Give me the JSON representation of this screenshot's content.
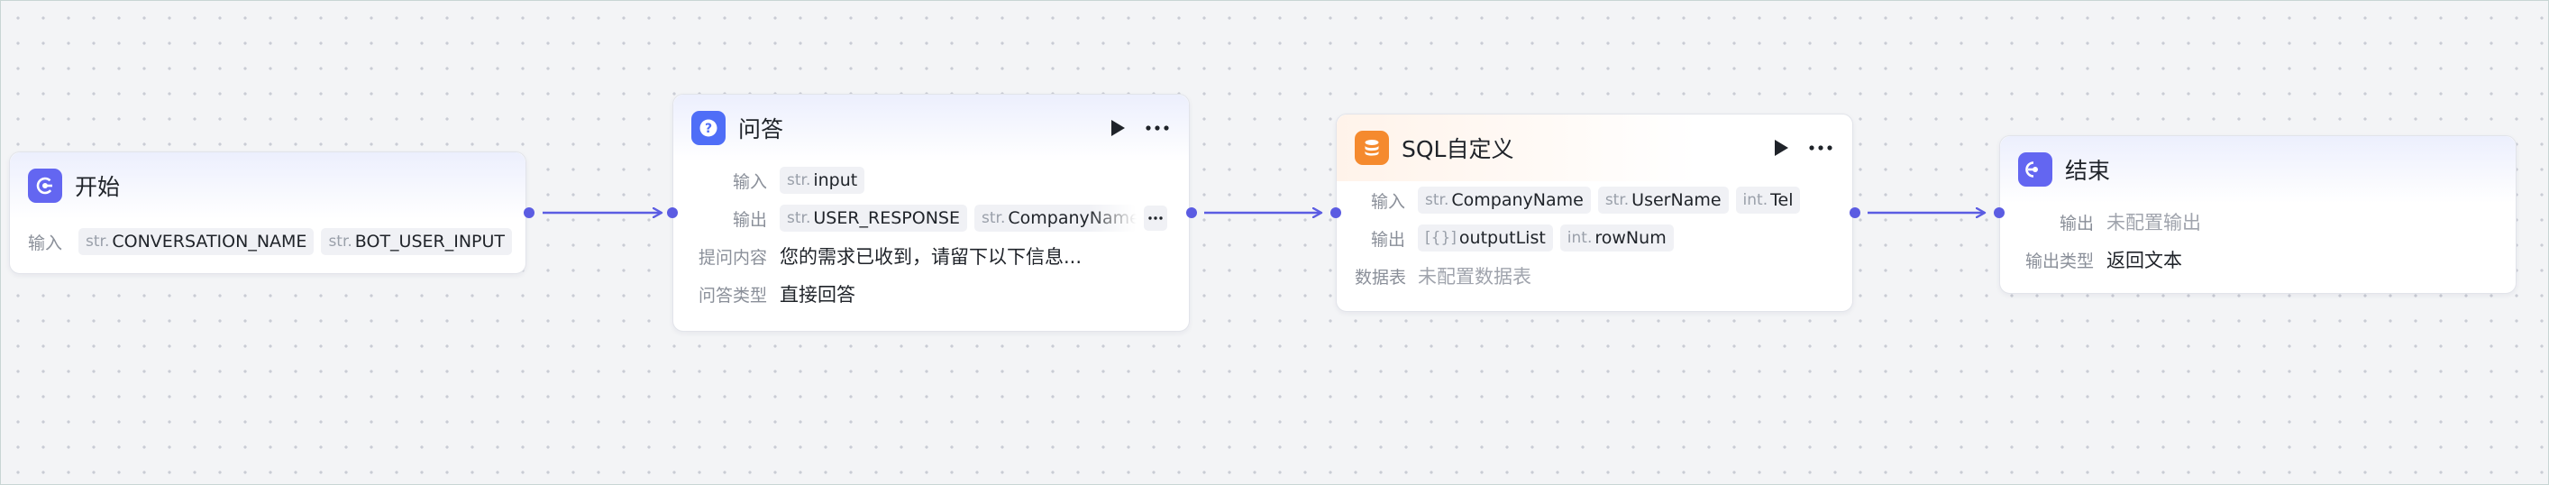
{
  "colors": {
    "accent": "#5b5ce2",
    "start_icon": "#6366f1",
    "qa_icon": "#4f6ef7",
    "sql_icon": "#f58a2e"
  },
  "nodes": {
    "start": {
      "title": "开始",
      "icon": "login-icon",
      "input_label": "输入",
      "inputs": [
        {
          "type": "str.",
          "name": "CONVERSATION_NAME"
        },
        {
          "type": "str.",
          "name": "BOT_USER_INPUT"
        }
      ]
    },
    "qa": {
      "title": "问答",
      "icon": "question-icon",
      "input_label": "输入",
      "inputs": [
        {
          "type": "str.",
          "name": "input"
        }
      ],
      "output_label": "输出",
      "outputs": [
        {
          "type": "str.",
          "name": "USER_RESPONSE"
        },
        {
          "type": "str.",
          "name": "CompanyName"
        }
      ],
      "prompt_label": "提问内容",
      "prompt_value": "您的需求已收到，请留下以下信息...",
      "answer_type_label": "问答类型",
      "answer_type_value": "直接回答"
    },
    "sql": {
      "title": "SQL自定义",
      "icon": "database-icon",
      "input_label": "输入",
      "inputs": [
        {
          "type": "str.",
          "name": "CompanyName"
        },
        {
          "type": "str.",
          "name": "UserName"
        },
        {
          "type": "int.",
          "name": "Tel"
        }
      ],
      "output_label": "输出",
      "outputs": [
        {
          "type": "[{}]",
          "name": "outputList"
        },
        {
          "type": "int.",
          "name": "rowNum"
        }
      ],
      "table_label": "数据表",
      "table_value": "未配置数据表"
    },
    "end": {
      "title": "结束",
      "icon": "exit-icon",
      "output_label": "输出",
      "output_value": "未配置输出",
      "output_type_label": "输出类型",
      "output_type_value": "返回文本"
    }
  }
}
